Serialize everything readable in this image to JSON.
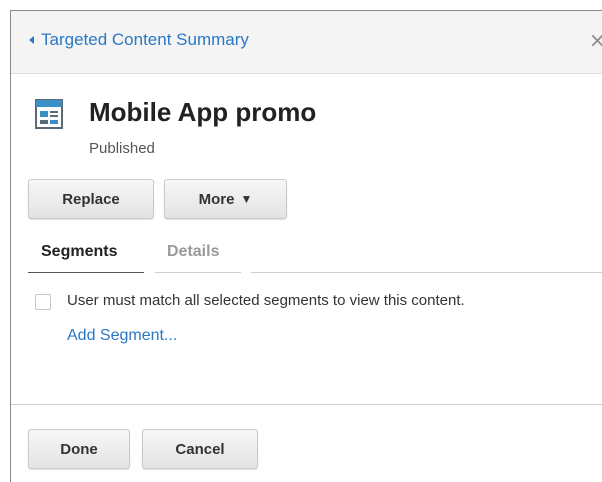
{
  "header": {
    "back_label": "Targeted Content Summary",
    "close_glyph": "×"
  },
  "content": {
    "icon": "content-document-icon",
    "title": "Mobile App promo",
    "status": "Published"
  },
  "actions": {
    "replace_label": "Replace",
    "more_label": "More",
    "more_caret": "▼"
  },
  "tabs": [
    {
      "label": "Segments",
      "active": true
    },
    {
      "label": "Details",
      "active": false
    }
  ],
  "segments": {
    "match_all_label": "User must match all selected segments to view this content.",
    "match_all_checked": false,
    "add_segment_label": "Add Segment..."
  },
  "footer": {
    "done_label": "Done",
    "cancel_label": "Cancel"
  },
  "colors": {
    "link": "#2a78c4",
    "header_bg": "#f4f4f4",
    "icon_accent": "#3a8fc8"
  }
}
